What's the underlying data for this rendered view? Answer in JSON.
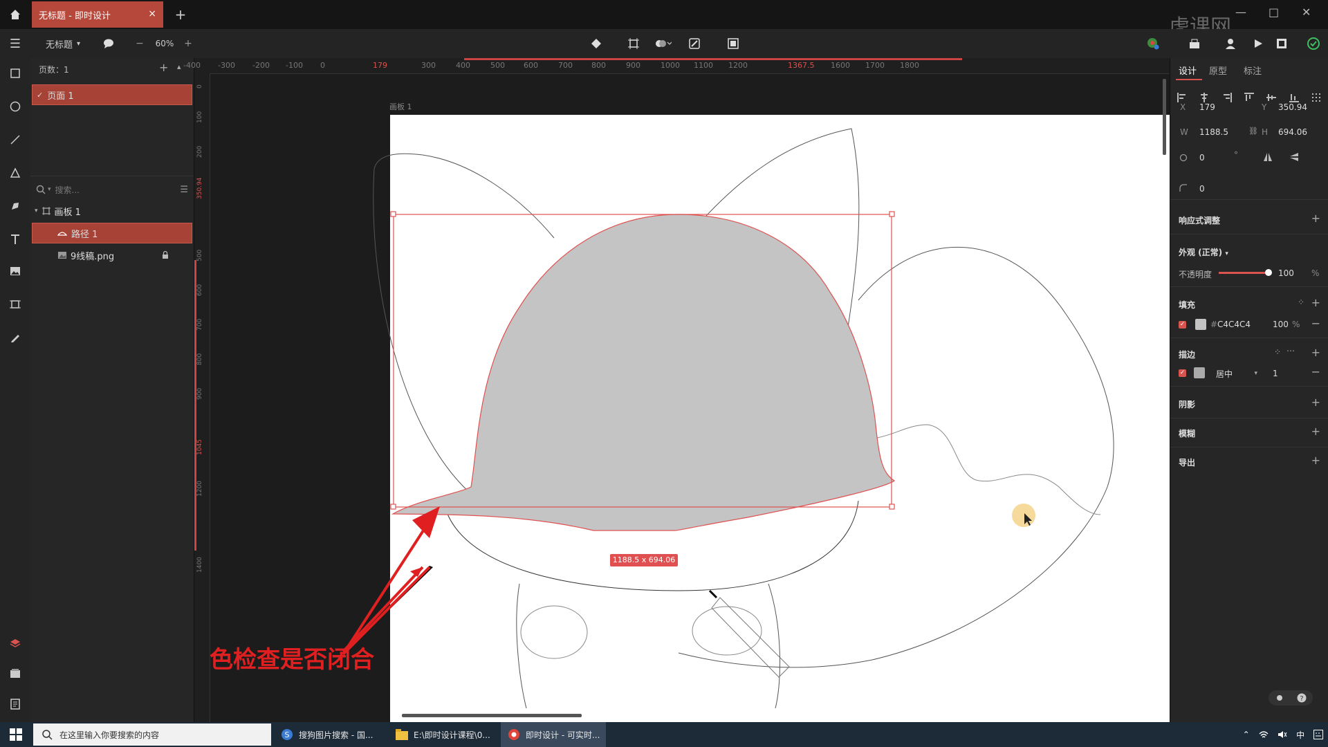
{
  "titlebar": {
    "tab_title": "无标题 - 即时设计",
    "close_glyph": "×",
    "add_glyph": "+",
    "win_minimize": "—",
    "win_maximize": "□",
    "win_close": "✕"
  },
  "toolbar": {
    "menu_glyph": "☰",
    "file_name": "无标题",
    "zoom_minus": "−",
    "zoom": "60%",
    "zoom_plus": "+"
  },
  "layers": {
    "pages_label": "页数：1",
    "page_item": "页面 1",
    "search_placeholder": "搜索...",
    "tree": [
      {
        "label": "画板 1"
      },
      {
        "label": "路径 1"
      },
      {
        "label": "9线稿.png"
      }
    ]
  },
  "canvas": {
    "artboard_label": "画板 1",
    "size_badge": "1188.5 x 694.06",
    "annotation": "填充颜色检查是否闭合",
    "fill_color": "#C4C4C4",
    "selection_color": "#e05050",
    "annotation_color": "#e02020",
    "hruler_labels": [
      "-400",
      "-300",
      "-200",
      "-100",
      "0",
      "179",
      "300",
      "400",
      "500",
      "600",
      "700",
      "800",
      "900",
      "1000",
      "1100",
      "1200",
      "1367.5",
      "1600",
      "1700",
      "1800"
    ],
    "vruler_labels": [
      "0",
      "100",
      "200",
      "350.94",
      "500",
      "600",
      "700",
      "800",
      "900",
      "1045",
      "1200",
      "1400"
    ]
  },
  "props": {
    "tabs": [
      "设计",
      "原型",
      "标注"
    ],
    "x_label": "X",
    "x_value": "179",
    "y_label": "Y",
    "y_value": "350.94",
    "w_label": "W",
    "w_value": "1188.5",
    "h_label": "H",
    "h_value": "694.06",
    "rotation_value": "0",
    "rotation_unit": "°",
    "radius_value": "0",
    "responsive_label": "响应式调整",
    "appearance_label": "外观 (正常)",
    "opacity_label": "不透明度",
    "opacity_value": "100",
    "opacity_fraction": 1.0,
    "percent_sign": "%",
    "fill_label": "填充",
    "fill_hash": "#",
    "fill_hex": "C4C4C4",
    "fill_opacity": "100",
    "stroke_label": "描边",
    "stroke_position": "居中",
    "stroke_width": "1",
    "shadow_label": "阴影",
    "blur_label": "模糊",
    "export_label": "导出",
    "plus_glyph": "+",
    "minus_glyph": "−"
  },
  "taskbar": {
    "search_placeholder": "在这里输入你要搜索的内容",
    "apps": [
      {
        "label": "搜狗图片搜索 - 国..."
      },
      {
        "label": "E:\\即时设计课程\\0..."
      },
      {
        "label": "即时设计 - 可实时..."
      }
    ],
    "ime": "中",
    "watermark": "虎课网"
  }
}
